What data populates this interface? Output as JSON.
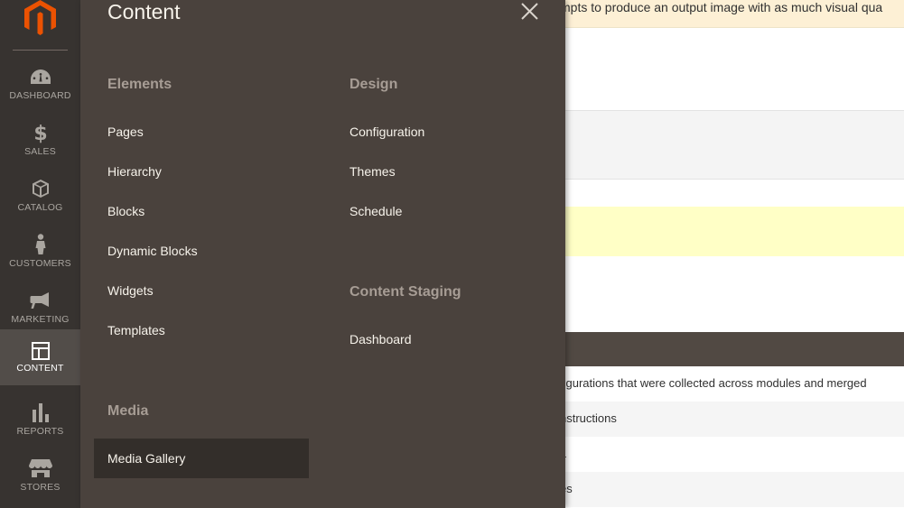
{
  "sidebar": {
    "logo_icon": "magento-logo-icon",
    "items": [
      {
        "label": "DASHBOARD",
        "icon": "dashboard-icon",
        "active": false
      },
      {
        "label": "SALES",
        "icon": "dollar-icon",
        "active": false
      },
      {
        "label": "CATALOG",
        "icon": "box-icon",
        "active": false
      },
      {
        "label": "CUSTOMERS",
        "icon": "person-icon",
        "active": false
      },
      {
        "label": "MARKETING",
        "icon": "megaphone-icon",
        "active": false
      },
      {
        "label": "CONTENT",
        "icon": "layout-icon",
        "active": true
      },
      {
        "label": "REPORTS",
        "icon": "bar-chart-icon",
        "active": false
      },
      {
        "label": "STORES",
        "icon": "store-icon",
        "active": false
      }
    ]
  },
  "flyout": {
    "title": "Content",
    "close_icon": "close-icon",
    "elements": {
      "title": "Elements",
      "links": [
        "Pages",
        "Hierarchy",
        "Blocks",
        "Dynamic Blocks",
        "Widgets",
        "Templates"
      ]
    },
    "media": {
      "title": "Media",
      "links": [
        "Media Gallery"
      ]
    },
    "design": {
      "title": "Design",
      "links": [
        "Configuration",
        "Themes",
        "Schedule"
      ]
    },
    "staging": {
      "title": "Content Staging",
      "links": [
        "Dashboard"
      ]
    }
  },
  "background": {
    "message": "mpts to produce an output image with as much visual qua",
    "rows": [
      "figurations that were collected across modules and merged",
      "nstructions",
      "L",
      "es"
    ]
  },
  "colors": {
    "sidebar_bg": "#373330",
    "flyout_bg": "#4a423d",
    "active_item_bg": "#524d49",
    "accent": "#eb5202"
  }
}
